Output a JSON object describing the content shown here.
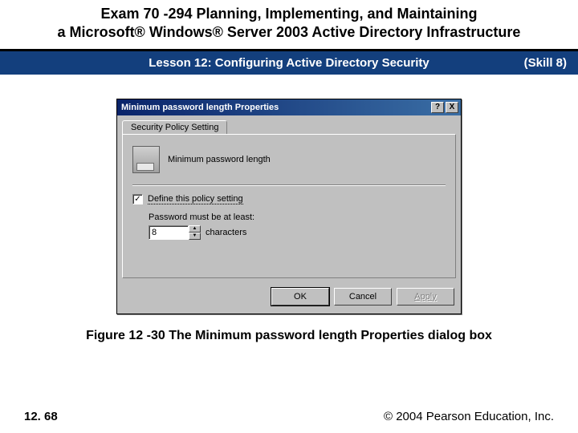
{
  "header": {
    "line1": "Exam 70 -294 Planning, Implementing, and Maintaining",
    "line2": "a Microsoft® Windows® Server 2003 Active Directory Infrastructure"
  },
  "subbar": {
    "lesson": "Lesson 12: Configuring Active Directory Security",
    "skill": "(Skill 8)"
  },
  "dialog": {
    "title": "Minimum password length Properties",
    "help_symbol": "?",
    "close_symbol": "X",
    "tab_label": "Security Policy Setting",
    "policy_name": "Minimum password length",
    "define_label": "Define this policy setting",
    "define_checked": true,
    "field_label": "Password must be at least:",
    "value": "8",
    "unit": "characters",
    "ok": "OK",
    "cancel": "Cancel",
    "apply": "Apply"
  },
  "caption": "Figure 12 -30 The Minimum password length Properties dialog box",
  "footer": {
    "page": "12. 68",
    "copyright": "© 2004 Pearson Education, Inc."
  }
}
